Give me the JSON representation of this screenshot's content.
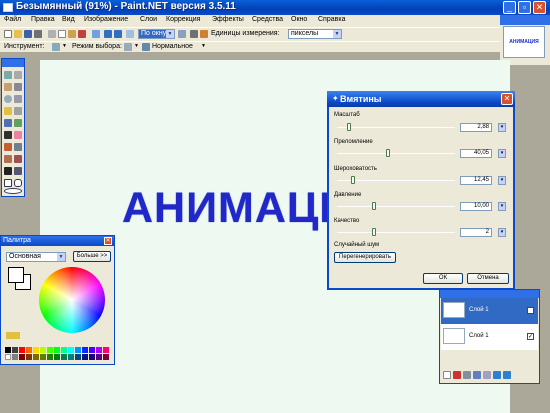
{
  "window": {
    "title": "Безымянный (91%) - Paint.NET версия 3.5.11"
  },
  "menu": [
    "Файл",
    "Правка",
    "Вид",
    "Изображение",
    "Слои",
    "Коррекция",
    "Эффекты",
    "Средства",
    "Окно",
    "Справка"
  ],
  "toolbar1": {
    "zoom_value": "По окну",
    "units_label": "Единицы измерения:",
    "units_value": "пикселы"
  },
  "toolbar2": {
    "tool_label": "Инструмент:",
    "selection_mode_label": "Режим выбора:",
    "blend_mode": "Нормальное"
  },
  "thumbnail": {
    "text": "АНИМАЦИЯ"
  },
  "canvas": {
    "text": "АНИМАЦИЯ"
  },
  "palette": {
    "title": "Палитра",
    "mode": "Основная",
    "more_button": "Больше >>"
  },
  "dialog": {
    "title": "Вмятины",
    "params": [
      {
        "label": "Масштаб",
        "value": "2,88"
      },
      {
        "label": "Преломление",
        "value": "40,05"
      },
      {
        "label": "Шероховатость",
        "value": "12,45"
      },
      {
        "label": "Давление",
        "value": "10,00"
      },
      {
        "label": "Качество",
        "value": "2"
      }
    ],
    "noise_label": "Случайный шум",
    "regenerate": "Перегенерировать",
    "ok": "ОК",
    "cancel": "Отмена"
  },
  "layers": {
    "items": [
      {
        "name": "Слой 1"
      },
      {
        "name": "Слой 1"
      }
    ]
  },
  "colors": {
    "accent": "#0a4ac8",
    "canvas_text": "#2028c8"
  }
}
